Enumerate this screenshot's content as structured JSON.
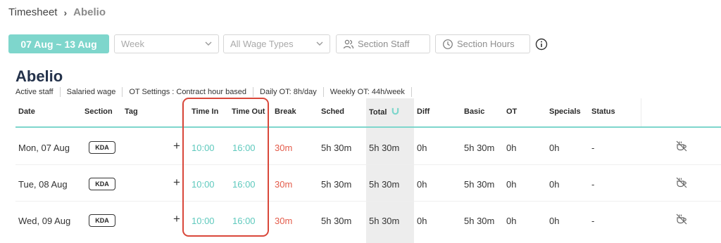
{
  "breadcrumb": {
    "root": "Timesheet",
    "separator": "›",
    "current": "Abelio"
  },
  "toolbar": {
    "date_range": "07 Aug ~ 13 Aug",
    "period_select": "Week",
    "wage_select": "All Wage Types",
    "section_staff": "Section Staff",
    "section_hours": "Section Hours"
  },
  "title": "Abelio",
  "meta": [
    "Active staff",
    "Salaried wage",
    "OT Settings : Contract hour based",
    "Daily OT: 8h/day",
    "Weekly OT: 44h/week"
  ],
  "columns": {
    "date": "Date",
    "section": "Section",
    "tag": "Tag",
    "time_in": "Time In",
    "time_out": "Time Out",
    "break": "Break",
    "sched": "Sched",
    "total": "Total",
    "diff": "Diff",
    "basic": "Basic",
    "ot": "OT",
    "specials": "Specials",
    "status": "Status"
  },
  "rows": [
    {
      "date": "Mon, 07 Aug",
      "section": "KDA",
      "add": "+",
      "time_in": "10:00",
      "time_out": "16:00",
      "break": "30m",
      "sched": "5h 30m",
      "total": "5h 30m",
      "diff": "0h",
      "basic": "5h 30m",
      "ot": "0h",
      "specials": "0h",
      "status": "-"
    },
    {
      "date": "Tue, 08 Aug",
      "section": "KDA",
      "add": "+",
      "time_in": "10:00",
      "time_out": "16:00",
      "break": "30m",
      "sched": "5h 30m",
      "total": "5h 30m",
      "diff": "0h",
      "basic": "5h 30m",
      "ot": "0h",
      "specials": "0h",
      "status": "-"
    },
    {
      "date": "Wed, 09 Aug",
      "section": "KDA",
      "add": "+",
      "time_in": "10:00",
      "time_out": "16:00",
      "break": "30m",
      "sched": "5h 30m",
      "total": "5h 30m",
      "diff": "0h",
      "basic": "5h 30m",
      "ot": "0h",
      "specials": "0h",
      "status": "-"
    }
  ],
  "colors": {
    "accent": "#7ed6cc",
    "time_text": "#5ec9bd",
    "break_text": "#e35b4a",
    "highlight": "#d9473a"
  },
  "icons": [
    "chevron-down-icon",
    "users-icon",
    "clock-icon",
    "info-icon",
    "magnet-icon",
    "no-break-cup-icon"
  ]
}
